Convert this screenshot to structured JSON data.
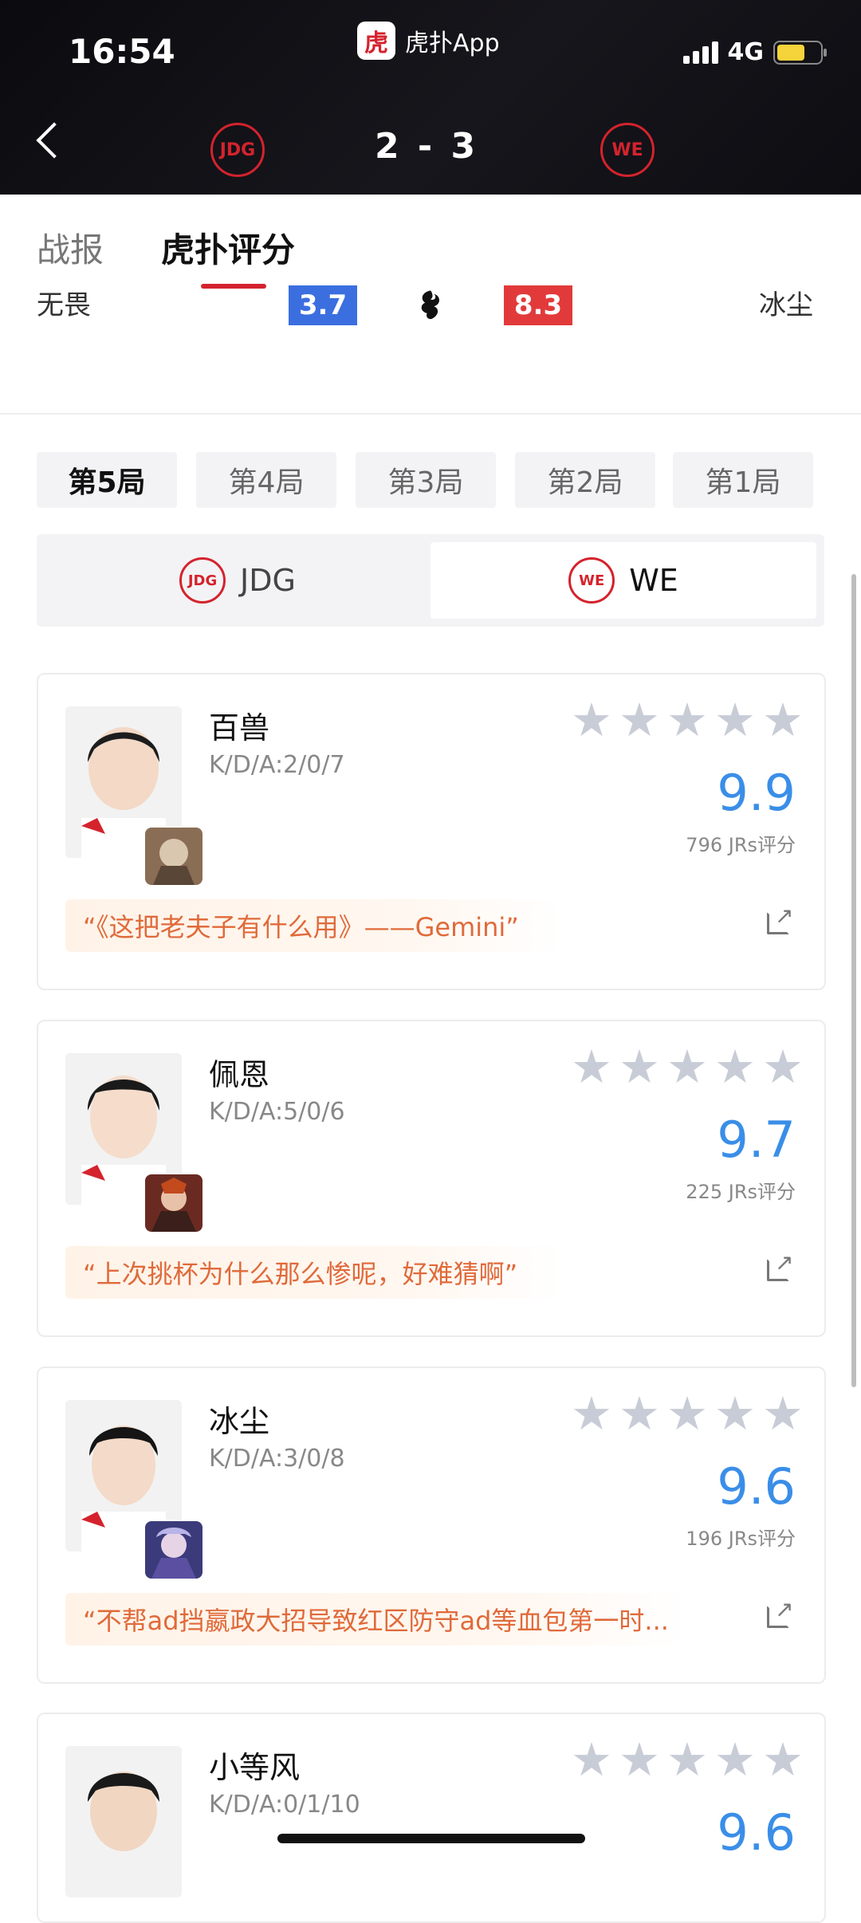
{
  "status_bar": {
    "time": "16:54",
    "app_name": "虎扑App",
    "app_logo_text": "虎扑",
    "network": "4G"
  },
  "match": {
    "score": "2 - 3",
    "left_team_logo": "JDG",
    "right_team_logo": "WE"
  },
  "tabs": [
    {
      "label": "战报"
    },
    {
      "label": "虎扑评分"
    }
  ],
  "summary": {
    "left_player": "无畏",
    "left_rating": "3.7",
    "right_rating": "8.3",
    "right_player": "冰尘",
    "center_icon": "dragon-icon"
  },
  "game_tabs": [
    "第5局",
    "第4局",
    "第3局",
    "第2局",
    "第1局"
  ],
  "team_toggle": [
    {
      "label": "JDG"
    },
    {
      "label": "WE"
    }
  ],
  "players": [
    {
      "name": "百兽",
      "kda": "K/D/A:2/0/7",
      "rating": "9.9",
      "votes": "796 JRs评分",
      "quote": "“《这把老夫子有什么用》——Gemini”"
    },
    {
      "name": "佩恩",
      "kda": "K/D/A:5/0/6",
      "rating": "9.7",
      "votes": "225 JRs评分",
      "quote": "“上次挑杯为什么那么惨呢，好难猜啊”"
    },
    {
      "name": "冰尘",
      "kda": "K/D/A:3/0/8",
      "rating": "9.6",
      "votes": "196 JRs评分",
      "quote": "“不帮ad挡嬴政大招导致红区防守ad等血包第一时..."
    },
    {
      "name": "小等风",
      "kda": "K/D/A:0/1/10",
      "rating": "9.6",
      "votes": "",
      "quote": ""
    }
  ],
  "colors": {
    "accent_red": "#d4232d",
    "rating_blue": "#3a8ee8",
    "quote_orange": "#e06a3a"
  }
}
